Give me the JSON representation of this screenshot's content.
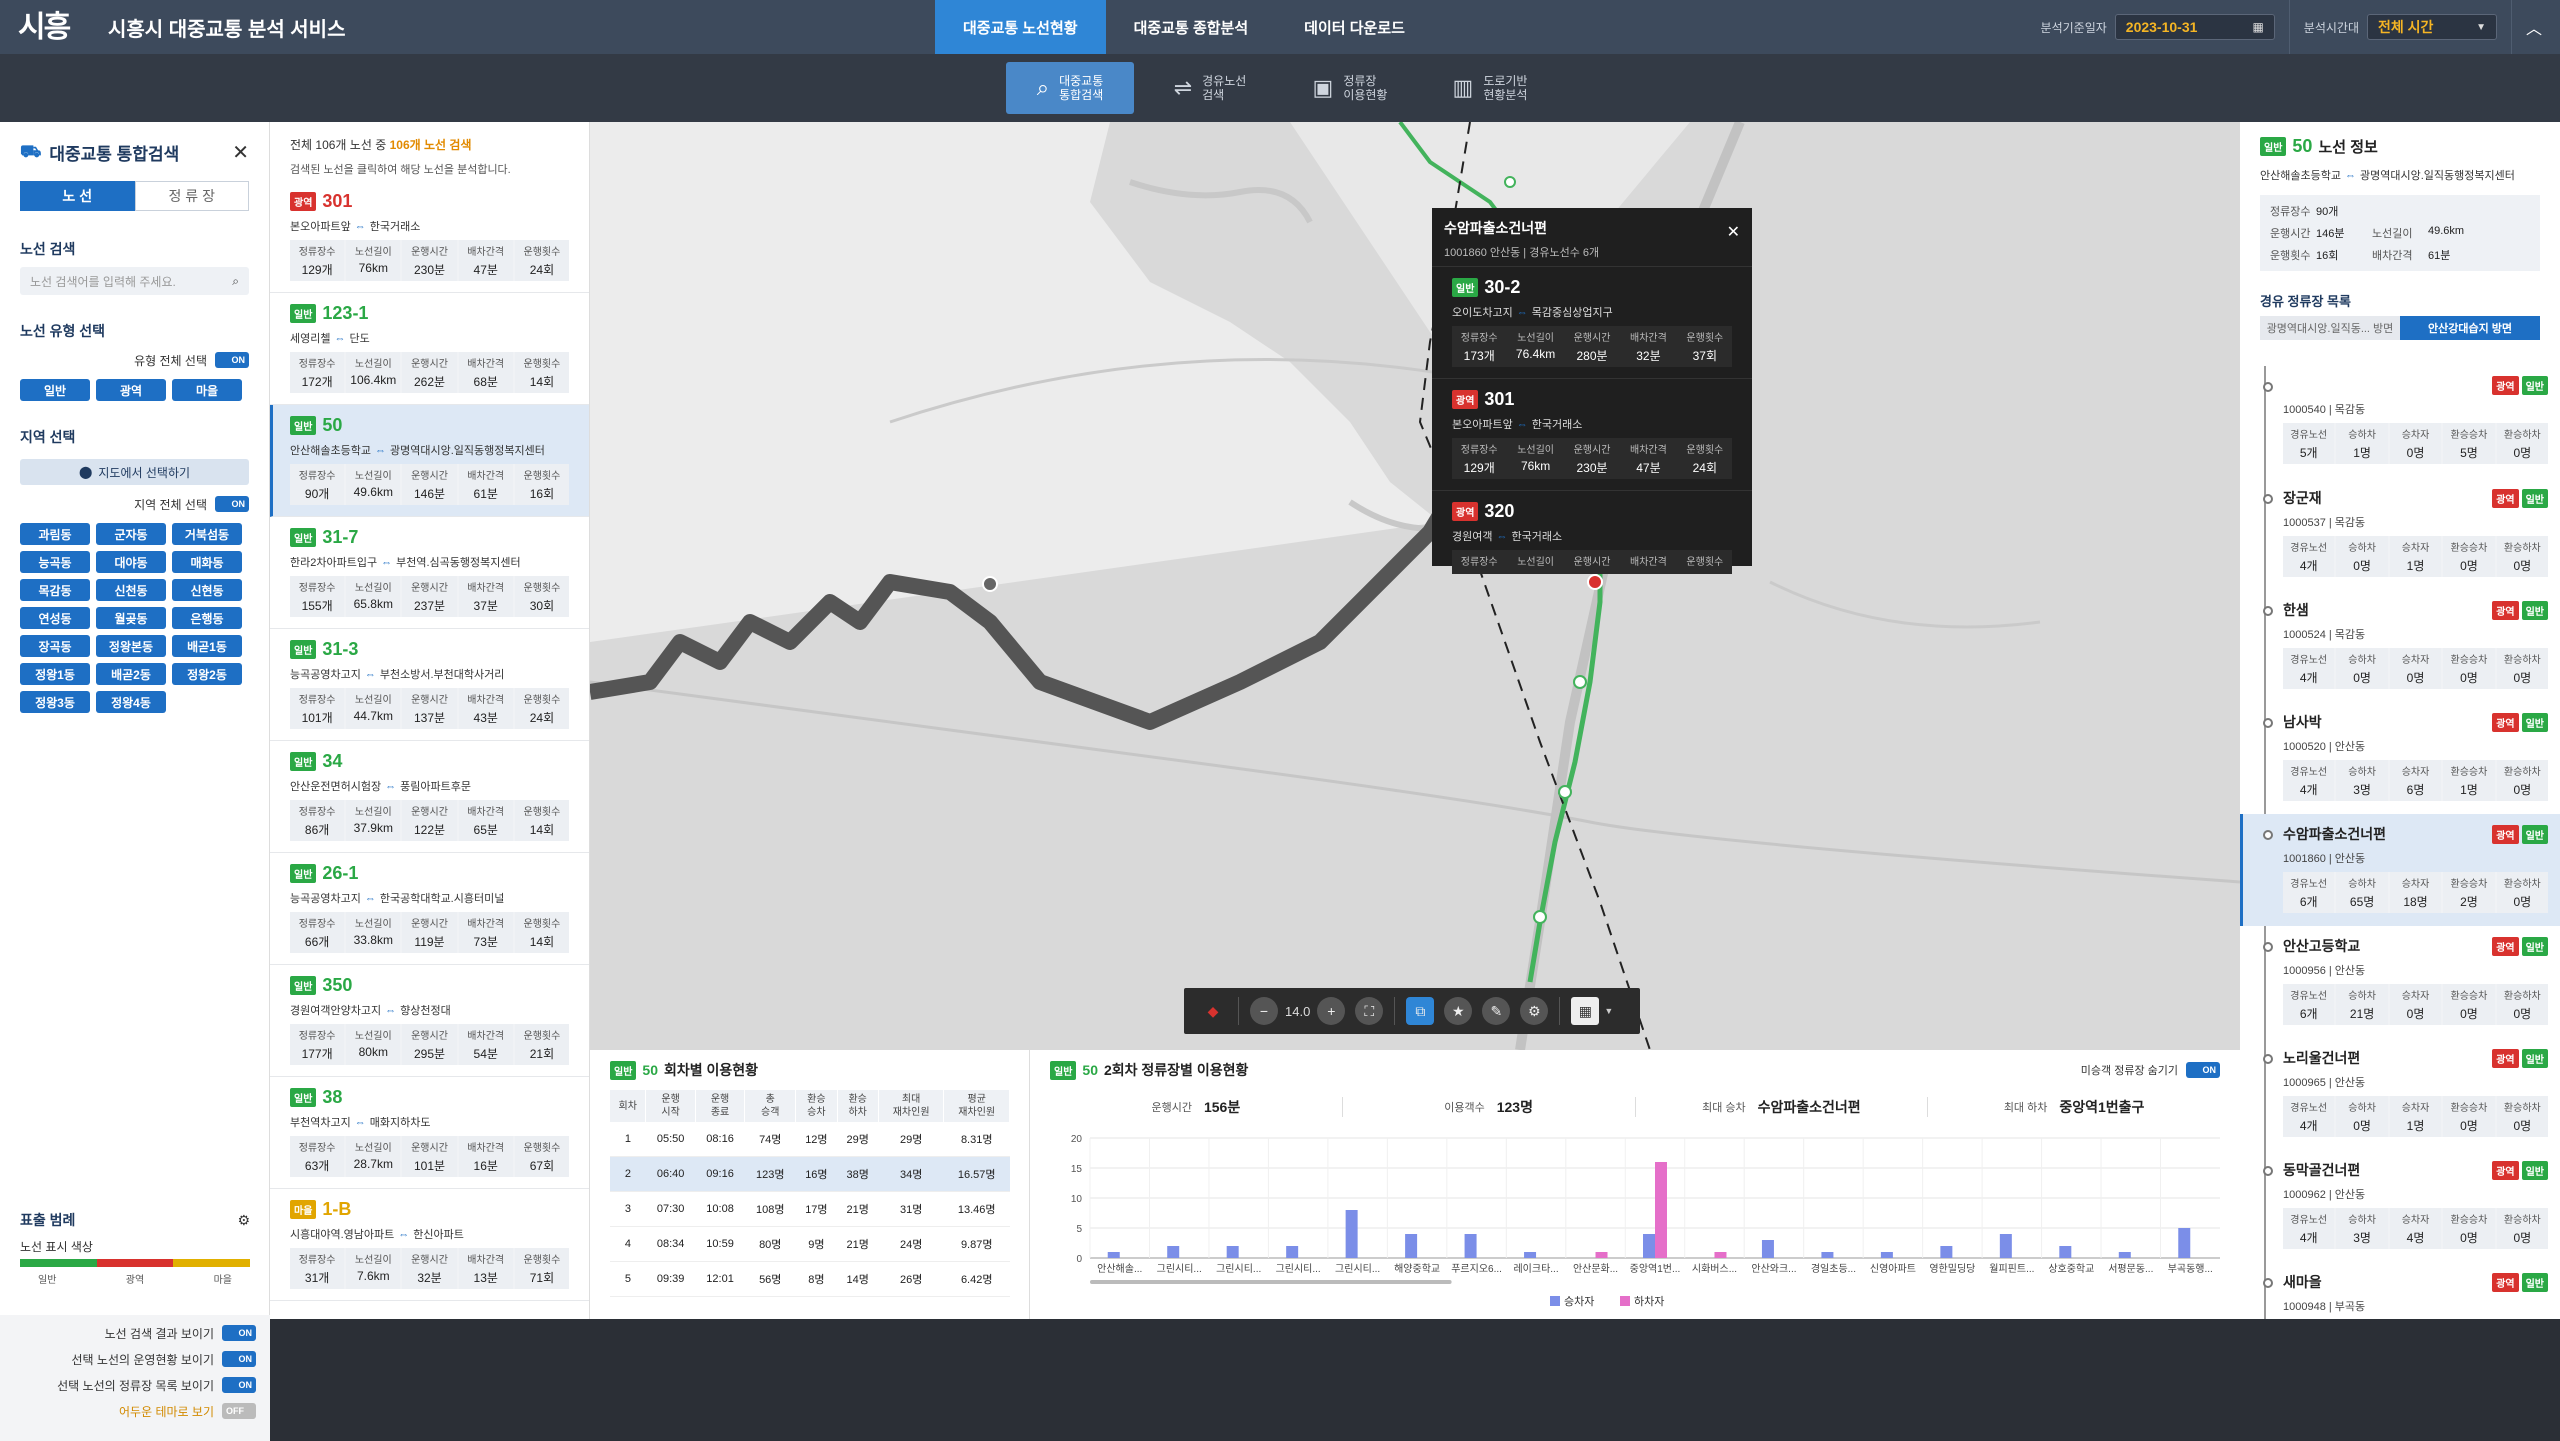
{
  "app": {
    "logo_text": "시흥",
    "title": "시흥시 대중교통 분석 서비스"
  },
  "nav": [
    {
      "label": "대중교통 노선현황",
      "active": true
    },
    {
      "label": "대중교통 종합분석",
      "active": false
    },
    {
      "label": "데이터 다운로드",
      "active": false
    }
  ],
  "topright": {
    "date_label": "분석기준일자",
    "date": "2023-10-31",
    "time_label": "분석시간대",
    "time": "전체 시간"
  },
  "subnav": [
    {
      "line1": "대중교통",
      "line2": "통합검색",
      "icon": "search-route-icon",
      "active": true
    },
    {
      "line1": "경유노선",
      "line2": "검색",
      "icon": "route-icon",
      "active": false
    },
    {
      "line1": "정류장",
      "line2": "이용현황",
      "icon": "bus-icon",
      "active": false
    },
    {
      "line1": "도로기반",
      "line2": "현황분석",
      "icon": "road-icon",
      "active": false
    }
  ],
  "left": {
    "title": "대중교통 통합검색",
    "tab_route": "노 선",
    "tab_stop": "정 류 장",
    "route_search_title": "노선 검색",
    "route_search_placeholder": "노선 검색어를 입력해 주세요.",
    "route_type_title": "노선 유형 선택",
    "type_all": "유형 전체 선택",
    "toggle_on": "ON",
    "toggle_off": "OFF",
    "types": [
      "일반",
      "광역",
      "마을"
    ],
    "region_title": "지역 선택",
    "map_select": "지도에서 선택하기",
    "region_all": "지역 전체 선택",
    "regions": [
      "과림동",
      "군자동",
      "거북섬동",
      "능곡동",
      "대야동",
      "매화동",
      "목감동",
      "신천동",
      "신현동",
      "연성동",
      "월곶동",
      "은행동",
      "장곡동",
      "정왕본동",
      "배곧1동",
      "정왕1동",
      "배곧2동",
      "정왕2동",
      "정왕3동",
      "정왕4동"
    ],
    "legend_title": "표출 범례",
    "legend_sub": "노선 표시 색상",
    "legend_labels": [
      "일반",
      "광역",
      "마을"
    ],
    "legend_colors": [
      "#2aa845",
      "#d8322e",
      "#e1b000"
    ],
    "options": [
      "노선 검색 결과 보이기",
      "선택 노선의 운영현황 보이기",
      "선택 노선의 정류장 목록 보이기",
      "어두운 테마로 보기"
    ]
  },
  "routes": {
    "head_prefix": "전체 106개 노선 중 ",
    "head_count": "106개 노선 검색",
    "sub": "검색된 노선을 클릭하여 해당 노선을 분석합니다.",
    "stat_labels": [
      "정류장수",
      "노선길이",
      "운행시간",
      "배차간격",
      "운행횟수"
    ],
    "items": [
      {
        "type": "광역",
        "color": "red",
        "num": "301",
        "from": "본오아파트앞",
        "to": "한국거래소",
        "stats": [
          "129개",
          "76km",
          "230분",
          "47분",
          "24회"
        ]
      },
      {
        "type": "일반",
        "color": "green",
        "num": "123-1",
        "from": "세영리첼",
        "to": "단도",
        "stats": [
          "172개",
          "106.4km",
          "262분",
          "68분",
          "14회"
        ]
      },
      {
        "type": "일반",
        "color": "green",
        "num": "50",
        "from": "안산해솔초등학교",
        "to": "광명역대시앙.일직동행정복지센터",
        "stats": [
          "90개",
          "49.6km",
          "146분",
          "61분",
          "16회"
        ],
        "sel": true
      },
      {
        "type": "일반",
        "color": "green",
        "num": "31-7",
        "from": "한라2차아파트입구",
        "to": "부천역.심곡동행정복지센터",
        "stats": [
          "155개",
          "65.8km",
          "237분",
          "37분",
          "30회"
        ]
      },
      {
        "type": "일반",
        "color": "green",
        "num": "31-3",
        "from": "능곡공영차고지",
        "to": "부천소방서.부천대학사거리",
        "stats": [
          "101개",
          "44.7km",
          "137분",
          "43분",
          "24회"
        ]
      },
      {
        "type": "일반",
        "color": "green",
        "num": "34",
        "from": "안산운전면허시험장",
        "to": "풍림아파트후문",
        "stats": [
          "86개",
          "37.9km",
          "122분",
          "65분",
          "14회"
        ]
      },
      {
        "type": "일반",
        "color": "green",
        "num": "26-1",
        "from": "능곡공영차고지",
        "to": "한국공학대학교.시흥터미널",
        "stats": [
          "66개",
          "33.8km",
          "119분",
          "73분",
          "14회"
        ]
      },
      {
        "type": "일반",
        "color": "green",
        "num": "350",
        "from": "경원여객안양차고지",
        "to": "향상천정대",
        "stats": [
          "177개",
          "80km",
          "295분",
          "54분",
          "21회"
        ]
      },
      {
        "type": "일반",
        "color": "green",
        "num": "38",
        "from": "부천역차고지",
        "to": "매화지하차도",
        "stats": [
          "63개",
          "28.7km",
          "101분",
          "16분",
          "67회"
        ]
      },
      {
        "type": "마을",
        "color": "yellow",
        "num": "1-B",
        "from": "시흥대야역.영남아파트",
        "to": "한신아파트",
        "stats": [
          "31개",
          "7.6km",
          "32분",
          "13분",
          "71회"
        ]
      }
    ]
  },
  "popup": {
    "title": "수암파출소건너편",
    "sub": "1001860 안산동 | 경유노선수 6개",
    "items": [
      {
        "type": "일반",
        "num": "30-2",
        "from": "오이도차고지",
        "to": "목감중심상업지구",
        "stats": [
          "173개",
          "76.4km",
          "280분",
          "32분",
          "37회"
        ]
      },
      {
        "type": "광역",
        "num": "301",
        "from": "본오아파트앞",
        "to": "한국거래소",
        "stats": [
          "129개",
          "76km",
          "230분",
          "47분",
          "24회"
        ]
      },
      {
        "type": "광역",
        "num": "320",
        "from": "경원여객",
        "to": "한국거래소",
        "stats": [
          "",
          "",
          "",
          "",
          ""
        ]
      }
    ]
  },
  "maptools": {
    "zoom": "14.0"
  },
  "right": {
    "type": "일반",
    "num": "50",
    "title_suffix": "노선 정보",
    "from": "안산해솔초등학교",
    "to": "광명역대시앙.일직동행정복지센터",
    "info": [
      [
        "정류장수",
        "90개",
        "",
        ""
      ],
      [
        "운행시간",
        "146분",
        "노선길이",
        "49.6km"
      ],
      [
        "운행횟수",
        "16회",
        "배차간격",
        "61분"
      ]
    ],
    "stops_title": "경유 정류장 목록",
    "tab_a": "광명역대시앙.일직동... 방면",
    "tab_b": "안산강대습지 방면",
    "stop_labels": [
      "경유노선",
      "승하차",
      "승차자",
      "환승승차",
      "환승하차"
    ],
    "stops": [
      {
        "name": "",
        "id": "1000540 | 목감동",
        "b": [
          "광역",
          "일반"
        ],
        "v": [
          "5개",
          "1명",
          "0명",
          "5명",
          "0명"
        ]
      },
      {
        "name": "장군재",
        "id": "1000537 | 목감동",
        "b": [
          "광역",
          "일반"
        ],
        "v": [
          "4개",
          "0명",
          "1명",
          "0명",
          "0명"
        ]
      },
      {
        "name": "한샘",
        "id": "1000524 | 목감동",
        "b": [
          "광역",
          "일반"
        ],
        "v": [
          "4개",
          "0명",
          "0명",
          "0명",
          "0명"
        ]
      },
      {
        "name": "남사박",
        "id": "1000520 | 안산동",
        "b": [
          "광역",
          "일반"
        ],
        "v": [
          "4개",
          "3명",
          "6명",
          "1명",
          "0명"
        ]
      },
      {
        "name": "수암파출소건너편",
        "id": "1001860 | 안산동",
        "b": [
          "광역",
          "일반"
        ],
        "v": [
          "6개",
          "65명",
          "18명",
          "2명",
          "0명"
        ],
        "sel": true
      },
      {
        "name": "안산고등학교",
        "id": "1000956 | 안산동",
        "b": [
          "광역",
          "일반"
        ],
        "v": [
          "6개",
          "21명",
          "0명",
          "0명",
          "0명"
        ]
      },
      {
        "name": "노리울건너편",
        "id": "1000965 | 안산동",
        "b": [
          "광역",
          "일반"
        ],
        "v": [
          "4개",
          "0명",
          "1명",
          "0명",
          "0명"
        ]
      },
      {
        "name": "동막골건너편",
        "id": "1000962 | 안산동",
        "b": [
          "광역",
          "일반"
        ],
        "v": [
          "4개",
          "3명",
          "4명",
          "0명",
          "0명"
        ]
      },
      {
        "name": "새마을",
        "id": "1000948 | 부곡동",
        "b": [
          "광역",
          "일반"
        ],
        "v": [
          "",
          "",
          "",
          "",
          ""
        ]
      }
    ]
  },
  "trips": {
    "type": "일반",
    "num": "50",
    "title": "회차별 이용현황",
    "headers": [
      "회차",
      "운행\n시작",
      "운행\n종료",
      "총\n승객",
      "환승\n승차",
      "환승\n하차",
      "최대\n재차인원",
      "평균\n재차인원"
    ],
    "rows": [
      [
        "1",
        "05:50",
        "08:16",
        "74명",
        "12명",
        "29명",
        "29명",
        "8.31명"
      ],
      [
        "2",
        "06:40",
        "09:16",
        "123명",
        "16명",
        "38명",
        "34명",
        "16.57명"
      ],
      [
        "3",
        "07:30",
        "10:08",
        "108명",
        "17명",
        "21명",
        "31명",
        "13.46명"
      ],
      [
        "4",
        "08:34",
        "10:59",
        "80명",
        "9명",
        "21명",
        "24명",
        "9.87명"
      ],
      [
        "5",
        "09:39",
        "12:01",
        "56명",
        "8명",
        "14명",
        "26명",
        "6.42명"
      ]
    ]
  },
  "stopchart": {
    "type": "일반",
    "num": "50",
    "title": "2회차 정류장별 이용현황",
    "hide_label": "미승객 정류장 숨기기",
    "kpis": [
      [
        "운행시간",
        "156분"
      ],
      [
        "이용객수",
        "123명"
      ],
      [
        "최대 승차",
        "수암파출소건너편"
      ],
      [
        "최대 하차",
        "중앙역1번출구"
      ]
    ],
    "legend": [
      "승차자",
      "하차자"
    ]
  },
  "chart_data": {
    "type": "bar",
    "ylim": [
      0,
      20
    ],
    "yticks": [
      0,
      5,
      10,
      15,
      20
    ],
    "categories": [
      "안산해솔...",
      "그린시티...",
      "그린시티...",
      "그린시티...",
      "그린시티...",
      "해양중학교",
      "푸르지오6...",
      "레이크타...",
      "안산문화...",
      "중앙역1번...",
      "시화버스...",
      "안산와크...",
      "경일초등...",
      "신영아파트",
      "영한밀딩당",
      "월피핀트...",
      "상호중학교",
      "서평문동...",
      "부곡동행..."
    ],
    "series": [
      {
        "name": "승차자",
        "color": "#7b8ee8",
        "values": [
          1,
          2,
          2,
          2,
          8,
          4,
          4,
          1,
          0,
          4,
          0,
          3,
          1,
          1,
          2,
          4,
          2,
          1,
          5
        ]
      },
      {
        "name": "하차자",
        "color": "#e56fc9",
        "values": [
          0,
          0,
          0,
          0,
          0,
          0,
          0,
          0,
          1,
          16,
          1,
          0,
          0,
          0,
          0,
          0,
          0,
          0,
          0
        ]
      }
    ]
  }
}
